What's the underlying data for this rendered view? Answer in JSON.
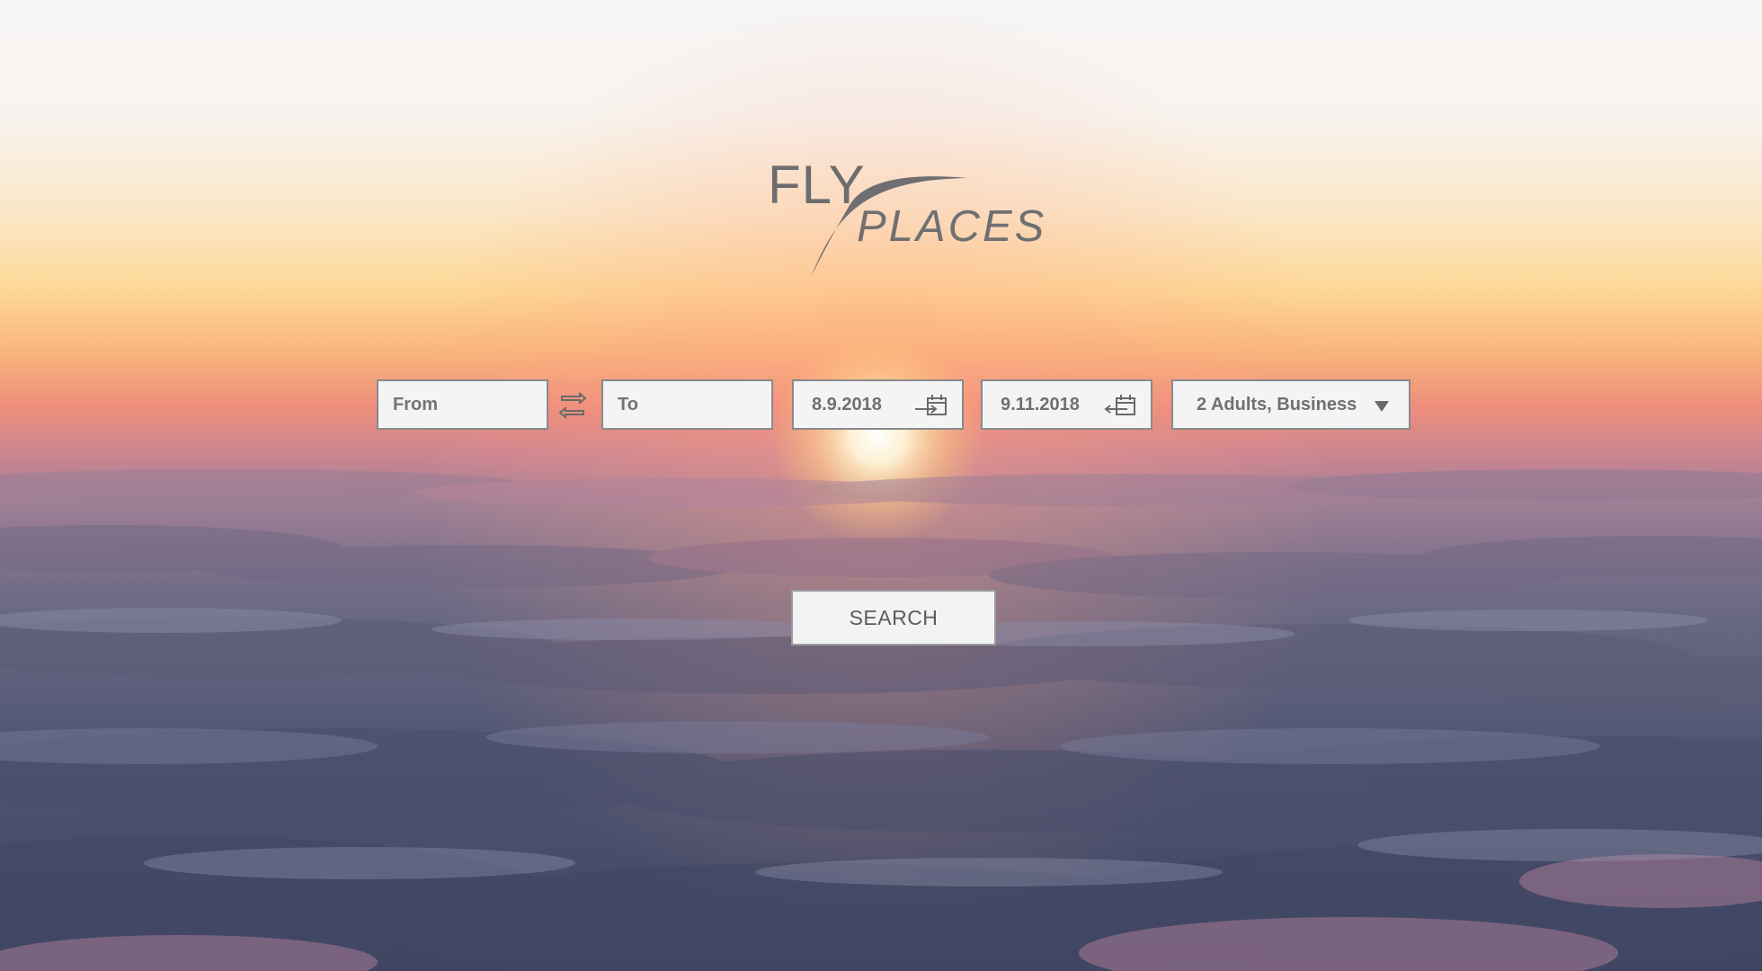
{
  "brand": {
    "line1": "FLY",
    "line2": "PLACES"
  },
  "search": {
    "from_placeholder": "From",
    "to_placeholder": "To",
    "depart_date": "8.9.2018",
    "return_date": "9.11.2018",
    "passengers_class": "2 Adults, Business",
    "submit_label": "SEARCH"
  },
  "icons": {
    "swap": "swap-arrows-icon",
    "depart": "calendar-depart-icon",
    "return": "calendar-return-icon",
    "dropdown": "caret-down-icon"
  },
  "colors": {
    "field_bg": "#f4f4f4",
    "field_border": "#8a8a8e",
    "text": "#707070"
  }
}
